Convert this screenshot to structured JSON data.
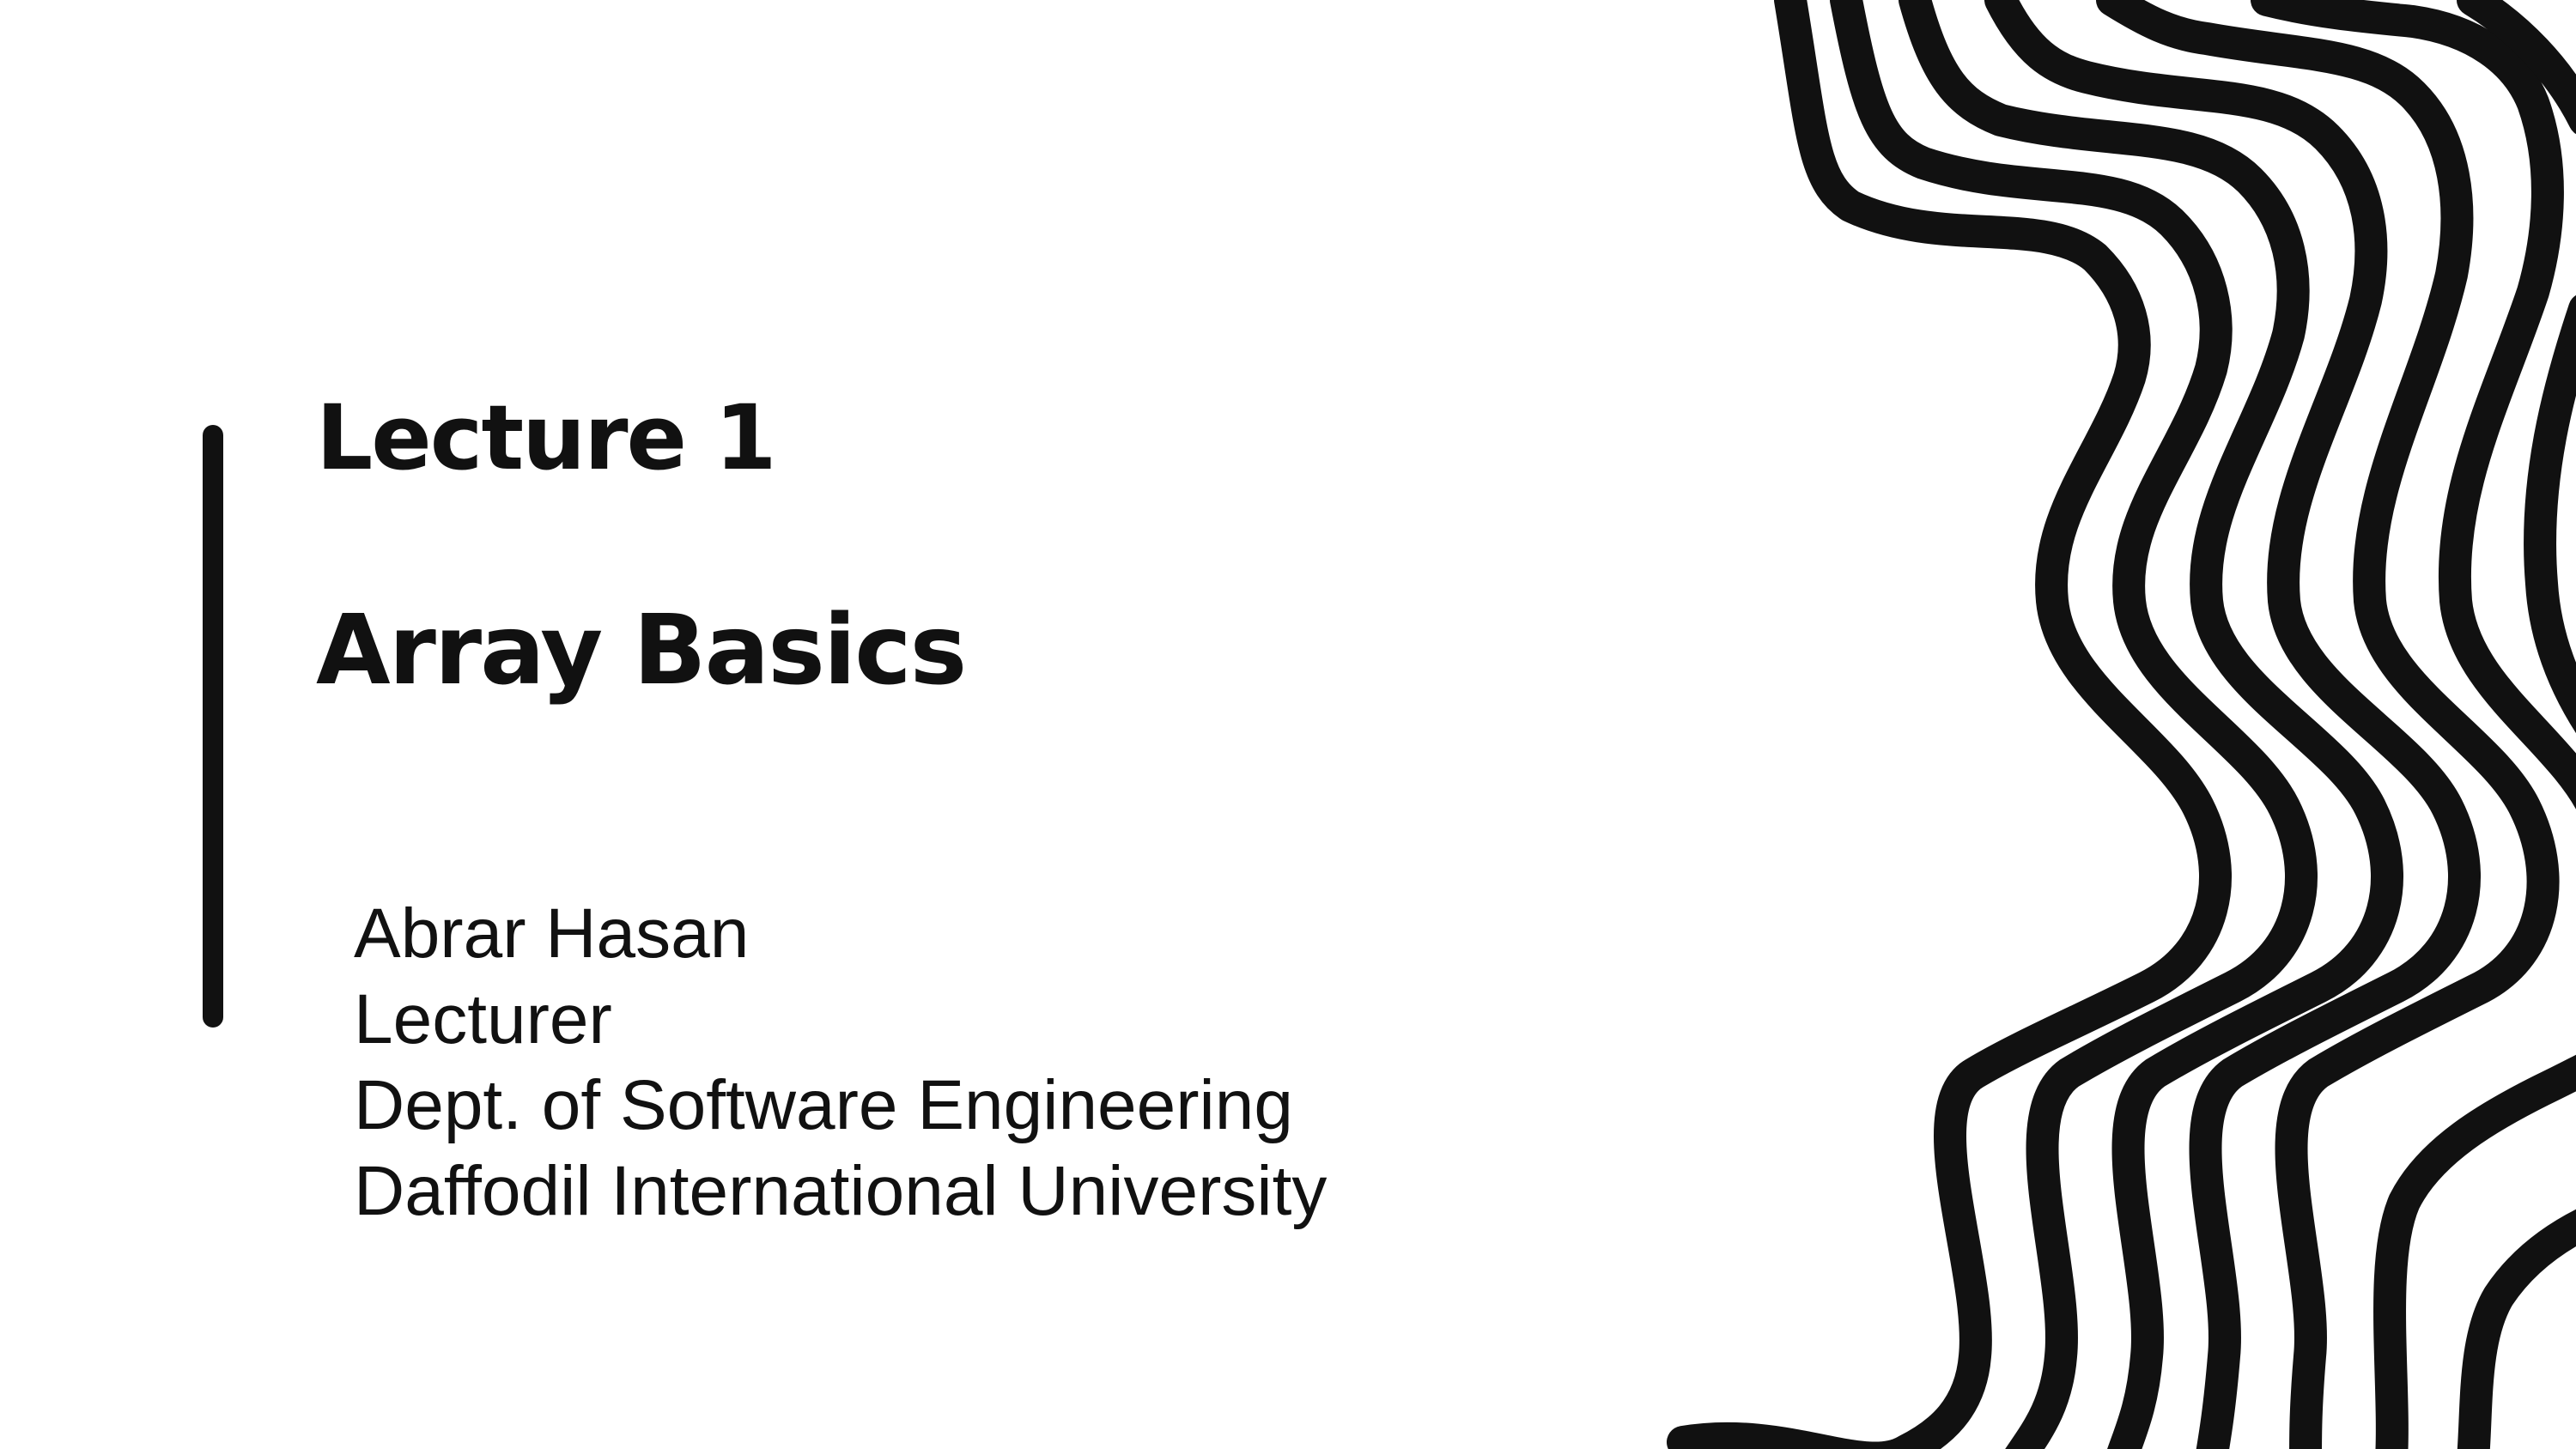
{
  "slide": {
    "title_line_1": "Lecture 1",
    "title_line_2": "Array Basics",
    "author": {
      "name": "Abrar Hasan",
      "role": "Lecturer",
      "department": "Dept. of Software Engineering",
      "institution": "Daffodil International University"
    },
    "colors": {
      "ink": "#111111",
      "background": "#ffffff"
    }
  }
}
